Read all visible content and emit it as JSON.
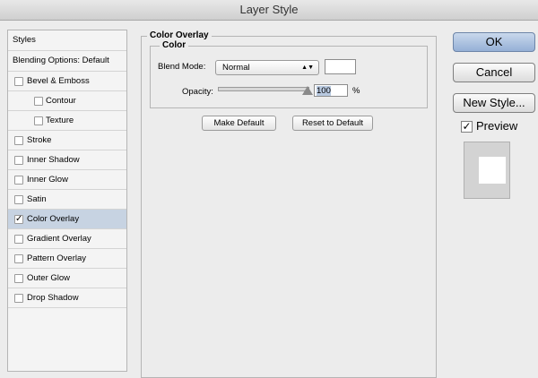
{
  "window": {
    "title": "Layer Style"
  },
  "sidebar": {
    "header": "Styles",
    "blending": "Blending Options: Default",
    "items": [
      {
        "label": "Bevel & Emboss",
        "checked": false,
        "level": 0
      },
      {
        "label": "Contour",
        "checked": false,
        "level": 1
      },
      {
        "label": "Texture",
        "checked": false,
        "level": 1
      },
      {
        "label": "Stroke",
        "checked": false,
        "level": 0
      },
      {
        "label": "Inner Shadow",
        "checked": false,
        "level": 0
      },
      {
        "label": "Inner Glow",
        "checked": false,
        "level": 0
      },
      {
        "label": "Satin",
        "checked": false,
        "level": 0
      },
      {
        "label": "Color Overlay",
        "checked": true,
        "level": 0,
        "selected": true
      },
      {
        "label": "Gradient Overlay",
        "checked": false,
        "level": 0
      },
      {
        "label": "Pattern Overlay",
        "checked": false,
        "level": 0
      },
      {
        "label": "Outer Glow",
        "checked": false,
        "level": 0
      },
      {
        "label": "Drop Shadow",
        "checked": false,
        "level": 0
      }
    ]
  },
  "panel": {
    "title": "Color Overlay",
    "group_title": "Color",
    "blend_mode_label": "Blend Mode:",
    "blend_mode_value": "Normal",
    "overlay_color": "#ffffff",
    "opacity_label": "Opacity:",
    "opacity_value": "100",
    "opacity_unit": "%",
    "opacity_fraction": 1.0,
    "make_default": "Make Default",
    "reset_default": "Reset to Default"
  },
  "actions": {
    "ok": "OK",
    "cancel": "Cancel",
    "new_style": "New Style...",
    "preview_label": "Preview",
    "preview_checked": true
  },
  "icons": {
    "checkmark": "✓",
    "select_arrows": "▲▼"
  }
}
